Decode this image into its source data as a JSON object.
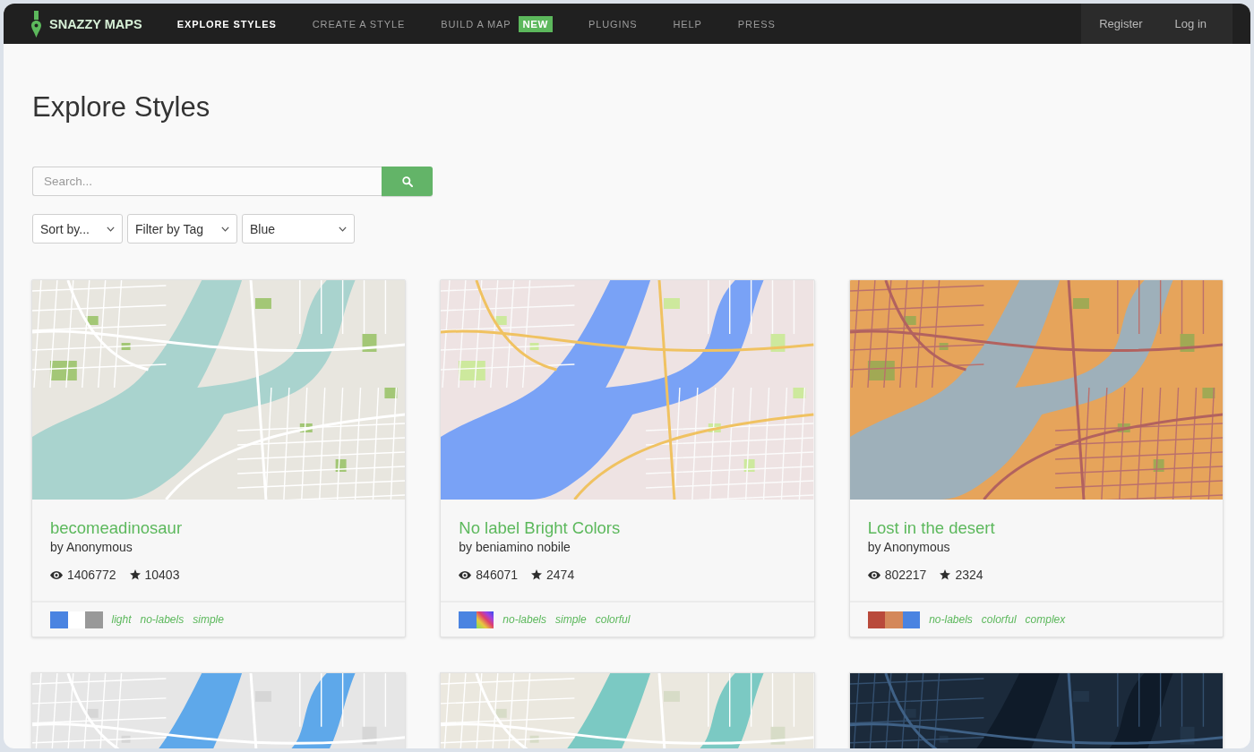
{
  "nav": {
    "logo": "SNAZZY MAPS",
    "links": [
      {
        "label": "EXPLORE STYLES",
        "selected": true
      },
      {
        "label": "CREATE A STYLE",
        "selected": false
      },
      {
        "label": "BUILD A MAP",
        "selected": false,
        "badge": "NEW"
      },
      {
        "label": "PLUGINS",
        "selected": false
      },
      {
        "label": "HELP",
        "selected": false
      },
      {
        "label": "PRESS",
        "selected": false
      }
    ],
    "account": [
      "Register",
      "Log in"
    ]
  },
  "page": {
    "title": "Explore Styles"
  },
  "search": {
    "placeholder": "Search..."
  },
  "filters": [
    {
      "value": "Sort by..."
    },
    {
      "value": "Filter by Tag"
    },
    {
      "value": "Blue"
    }
  ],
  "cards": [
    {
      "kind": "light",
      "title": "becomeadinosaur",
      "author": "by Anonymous",
      "views": "1406772",
      "favorites": "10403",
      "swatches": [
        {
          "kind": "solid",
          "color": "#4a84e1"
        },
        {
          "kind": "solid",
          "color": "#ffffff"
        },
        {
          "kind": "solid",
          "color": "#999999"
        }
      ],
      "tags": [
        "light",
        "no-labels",
        "simple"
      ]
    },
    {
      "kind": "bright",
      "title": "No label Bright Colors",
      "author": "by beniamino nobile",
      "views": "846071",
      "favorites": "2474",
      "swatches": [
        {
          "kind": "solid",
          "color": "#4a84e1"
        },
        {
          "kind": "rainbow"
        }
      ],
      "tags": [
        "no-labels",
        "simple",
        "colorful"
      ]
    },
    {
      "kind": "desert",
      "title": "Lost in the desert",
      "author": "by Anonymous",
      "views": "802217",
      "favorites": "2324",
      "swatches": [
        {
          "kind": "solid",
          "color": "#b94a3b"
        },
        {
          "kind": "solid",
          "color": "#d4885a"
        },
        {
          "kind": "solid",
          "color": "#4a84e1"
        }
      ],
      "tags": [
        "no-labels",
        "colorful",
        "complex"
      ]
    },
    {
      "kind": "grey"
    },
    {
      "kind": "aqua"
    },
    {
      "kind": "dark"
    }
  ]
}
